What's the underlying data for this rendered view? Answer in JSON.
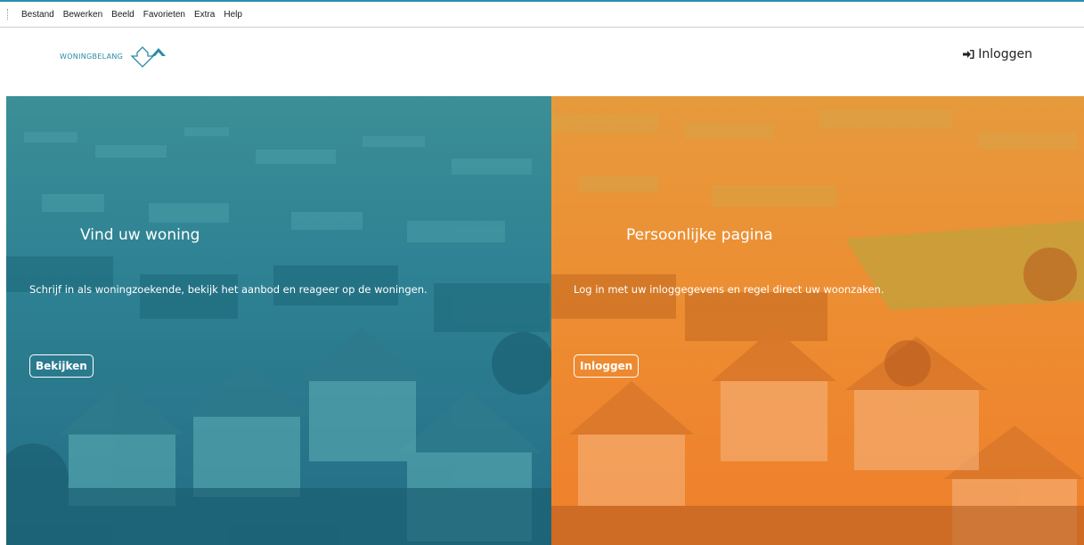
{
  "menubar": {
    "items": [
      "Bestand",
      "Bewerken",
      "Beeld",
      "Favorieten",
      "Extra",
      "Help"
    ]
  },
  "header": {
    "logo_text": "WONINGBELANG",
    "login_label": "Inloggen",
    "login_icon": "sign-in-icon"
  },
  "colors": {
    "teal_overlay": "#1f8fa3",
    "orange_overlay": "#f08a2e",
    "logo_teal": "#2a8aa6"
  },
  "left_panel": {
    "title": "Vind uw woning",
    "text": "Schrijf in als woningzoekende, bekijk het aanbod en reageer op de woningen.",
    "button_label": "Bekijken"
  },
  "right_panel": {
    "title": "Persoonlijke pagina",
    "text": "Log in met uw inloggegevens en regel direct uw woonzaken.",
    "button_label": "Inloggen"
  }
}
